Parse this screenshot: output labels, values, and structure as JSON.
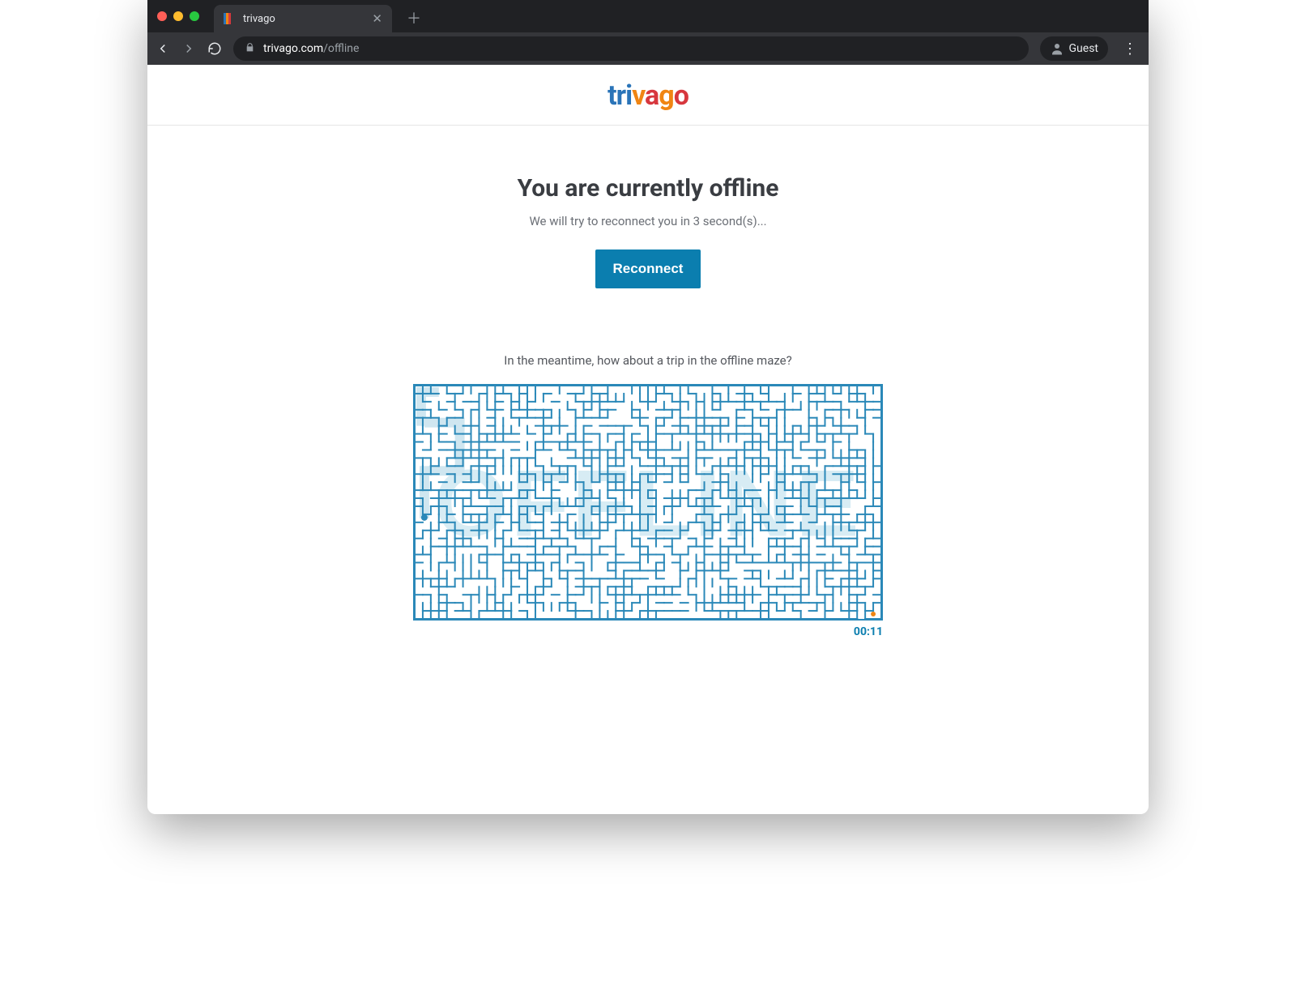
{
  "browser": {
    "tab_title": "trivago",
    "url_domain": "trivago.com",
    "url_path": "/offline",
    "guest_label": "Guest",
    "favicon_colors": [
      "#2a74b8",
      "#f08513",
      "#d7373e"
    ]
  },
  "logo": {
    "text_parts": [
      "t",
      "r",
      "i",
      "v",
      "a",
      "g",
      "o"
    ]
  },
  "offline": {
    "heading": "You are currently offline",
    "subtext": "We will try to reconnect you in 3 second(s)...",
    "button_label": "Reconnect"
  },
  "maze": {
    "caption": "In the meantime, how about a trip in the offline maze?",
    "timer": "00:11",
    "watermark": "OFFLINE",
    "wall_color": "#2a88b8",
    "bg_letter_color": "#d7ecf4",
    "trail_color": "#cfe6f0"
  }
}
